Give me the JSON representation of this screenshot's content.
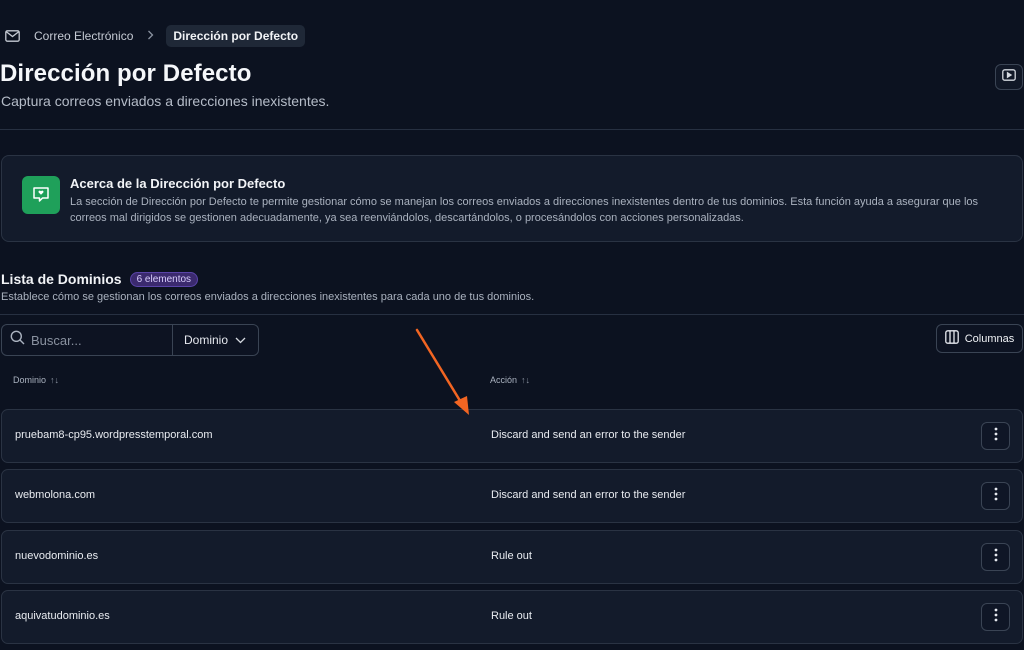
{
  "breadcrumb": {
    "parent": "Correo Electrónico",
    "separator": ">",
    "current": "Dirección por Defecto"
  },
  "header": {
    "title": "Dirección por Defecto",
    "subtitle": "Captura correos enviados a direcciones inexistentes."
  },
  "info": {
    "title": "Acerca de la Dirección por Defecto",
    "text": "La sección de Dirección por Defecto te permite gestionar cómo se manejan los correos enviados a direcciones inexistentes dentro de tus dominios. Esta función ayuda a asegurar que los correos mal dirigidos se gestionen adecuadamente, ya sea reenviándolos, descartándolos, o procesándolos con acciones personalizadas."
  },
  "list": {
    "title": "Lista de Dominios",
    "count_badge": "6 elementos",
    "description": "Establece cómo se gestionan los correos enviados a direcciones inexistentes para cada uno de tus dominios."
  },
  "toolbar": {
    "search_placeholder": "Buscar...",
    "filter_value": "Dominio",
    "columns_label": "Columnas"
  },
  "table": {
    "headers": {
      "domain": "Dominio",
      "action": "Acción",
      "sort_glyph": "↑↓"
    },
    "rows": [
      {
        "domain": "pruebam8-cp95.wordpresstemporal.com",
        "action": "Discard and send an error to the sender"
      },
      {
        "domain": "webmolona.com",
        "action": "Discard and send an error to the sender"
      },
      {
        "domain": "nuevodominio.es",
        "action": "Rule out"
      },
      {
        "domain": "aquivatudominio.es",
        "action": "Rule out"
      }
    ]
  },
  "colors": {
    "background": "#0c1220",
    "card": "#131b2b",
    "accent_green": "#1fa05a",
    "badge_purple": "#3b2a6e",
    "annotation_arrow": "#f26522"
  },
  "icons": {
    "breadcrumb": "mail-icon",
    "header_action": "video-icon",
    "info": "shield-chat-icon",
    "search": "search-icon",
    "filter": "chevron-down-icon",
    "columns": "columns-icon",
    "row_menu": "kebab-menu-icon"
  }
}
